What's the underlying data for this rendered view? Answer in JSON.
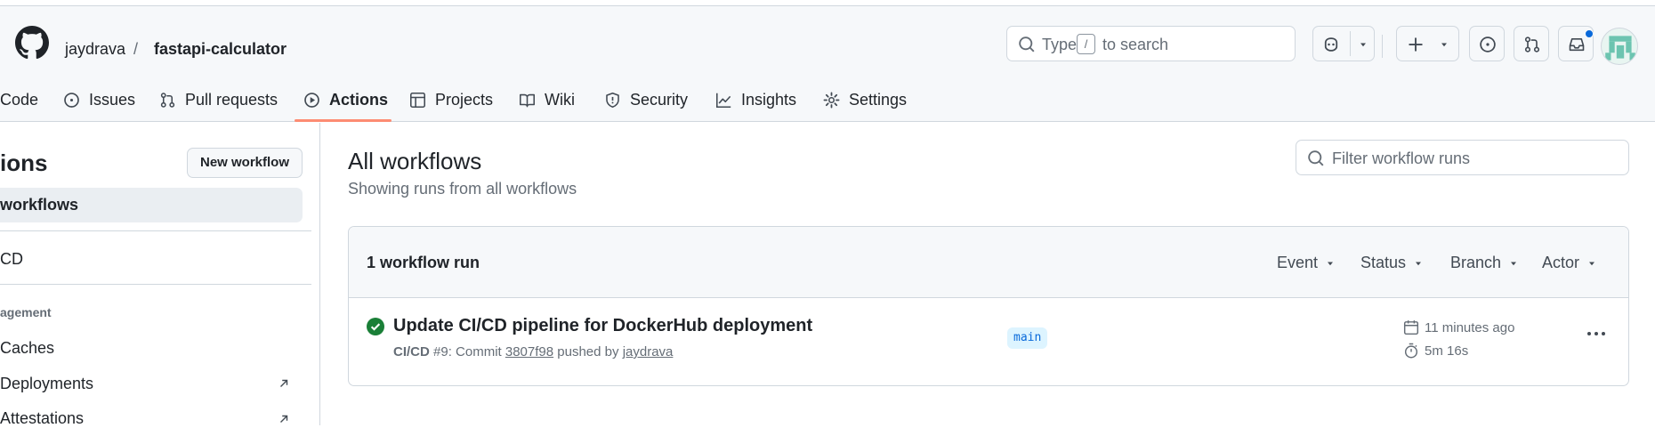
{
  "repo": {
    "owner": "jaydrava",
    "separator": "/",
    "name": "fastapi-calculator"
  },
  "search": {
    "prefix": "Type",
    "key": "/",
    "suffix": "to search"
  },
  "header_buttons": [
    "copilot-icon",
    "plus-icon",
    "issue-opened-icon",
    "git-pull-request-icon",
    "inbox-icon"
  ],
  "tabs": [
    {
      "label": "Code",
      "icon": "code-icon"
    },
    {
      "label": "Issues",
      "icon": "issue-opened-icon"
    },
    {
      "label": "Pull requests",
      "icon": "git-pull-request-icon"
    },
    {
      "label": "Actions",
      "icon": "play-icon",
      "active": true
    },
    {
      "label": "Projects",
      "icon": "table-icon"
    },
    {
      "label": "Wiki",
      "icon": "book-icon"
    },
    {
      "label": "Security",
      "icon": "shield-icon"
    },
    {
      "label": "Insights",
      "icon": "graph-icon"
    },
    {
      "label": "Settings",
      "icon": "gear-icon"
    }
  ],
  "sidebar": {
    "title": "ions",
    "new_workflow": "New workflow",
    "selected": "workflows",
    "workflow": "CD",
    "section": "agement",
    "items": [
      "Caches",
      "Deployments",
      "Attestations"
    ]
  },
  "main": {
    "title": "All workflows",
    "subtitle": "Showing runs from all workflows",
    "filter_placeholder": "Filter workflow runs"
  },
  "runs_box": {
    "count": "1 workflow run",
    "filters": [
      "Event",
      "Status",
      "Branch",
      "Actor"
    ],
    "runs": [
      {
        "title": "Update CI/CD pipeline for DockerHub deployment",
        "workflow": "CI/CD",
        "number": "#9: Commit",
        "commit": "3807f98",
        "pushed_by": "pushed by",
        "actor": "jaydrava",
        "branch": "main",
        "when": "11 minutes ago",
        "duration": "5m 16s",
        "status": "success"
      }
    ]
  },
  "colors": {
    "accent": "#0969da",
    "success": "#1a7f37",
    "tab_underline": "#fd8c73"
  }
}
